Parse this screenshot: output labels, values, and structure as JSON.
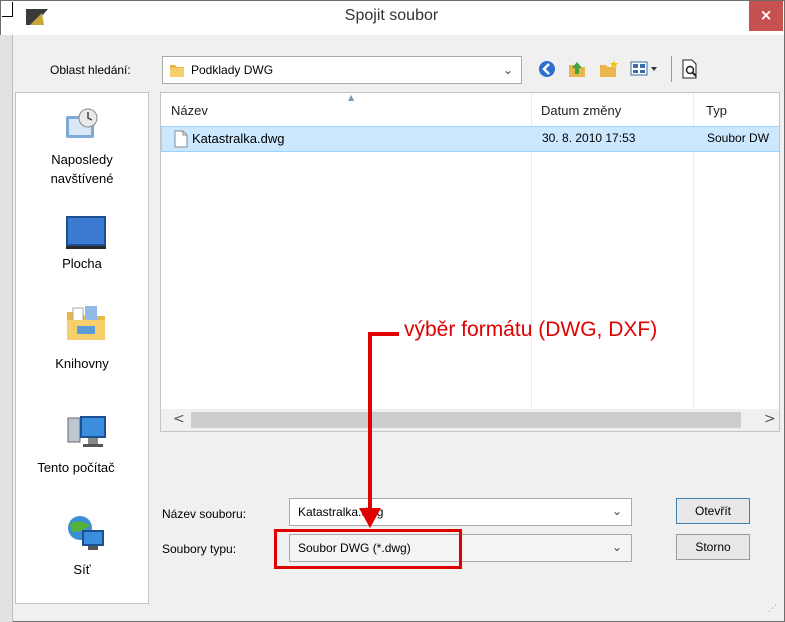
{
  "window": {
    "title": "Spojit soubor",
    "close_glyph": "×"
  },
  "toolbar": {
    "look_in_label": "Oblast hledání:",
    "look_in_value": "Podklady DWG",
    "icons": [
      "back-icon",
      "up-folder-icon",
      "new-folder-icon",
      "views-icon",
      "preview-icon"
    ]
  },
  "places": [
    {
      "label_line1": "Naposledy",
      "label_line2": "navštívené",
      "icon": "recent-places-icon"
    },
    {
      "label_line1": "Plocha",
      "label_line2": "",
      "icon": "desktop-icon"
    },
    {
      "label_line1": "Knihovny",
      "label_line2": "",
      "icon": "libraries-icon"
    },
    {
      "label_line1": "Tento počítač",
      "label_line2": "",
      "icon": "this-pc-icon"
    },
    {
      "label_line1": "Síť",
      "label_line2": "",
      "icon": "network-icon"
    }
  ],
  "filelist": {
    "columns": {
      "name": "Název",
      "date": "Datum změny",
      "type": "Typ"
    },
    "rows": [
      {
        "name": "Katastralka.dwg",
        "date": "30. 8. 2010 17:53",
        "type": "Soubor DW"
      }
    ]
  },
  "scrollbar": {
    "left_arrow": "<",
    "right_arrow": ">"
  },
  "form": {
    "filename_label": "Název souboru:",
    "filename_value": "Katastralka.dwg",
    "filetype_label": "Soubory typu:",
    "filetype_value": "Soubor DWG (*.dwg)"
  },
  "buttons": {
    "open": "Otevřít",
    "cancel": "Storno"
  },
  "annotation": {
    "text": "výběr formátu (DWG, DXF)",
    "color": "#e00000"
  },
  "colors": {
    "selection_fill": "#cce8ff",
    "selection_border": "#99d1ff",
    "close_button": "#c75050"
  }
}
